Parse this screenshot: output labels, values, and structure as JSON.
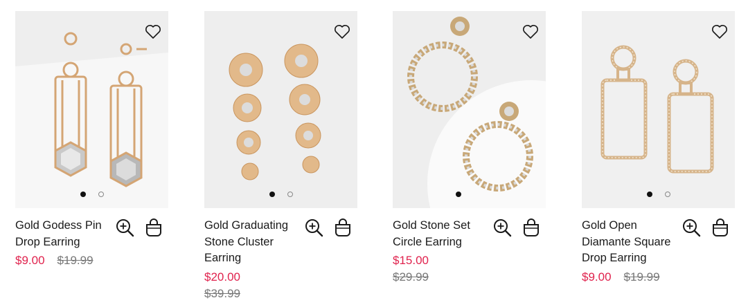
{
  "products": [
    {
      "name": "Gold Godess Pin Drop Earring",
      "price": "$9.00",
      "was_price": "$19.99",
      "image_dots": 2,
      "active_dot": 1,
      "icons": {
        "wishlist": "heart-outline-icon",
        "zoom": "zoom-in-icon",
        "bag": "shopping-bag-icon"
      }
    },
    {
      "name": "Gold Graduating Stone Cluster Earring",
      "price": "$20.00",
      "was_price": "$39.99",
      "image_dots": 2,
      "active_dot": 1,
      "icons": {
        "wishlist": "heart-outline-icon",
        "zoom": "zoom-in-icon",
        "bag": "shopping-bag-icon"
      }
    },
    {
      "name": "Gold Stone Set Circle Earring",
      "price": "$15.00",
      "was_price": "$29.99",
      "image_dots": 1,
      "active_dot": 1,
      "icons": {
        "wishlist": "heart-outline-icon",
        "zoom": "zoom-in-icon",
        "bag": "shopping-bag-icon"
      }
    },
    {
      "name": "Gold Open Diamante Square Drop Earring",
      "price": "$9.00",
      "was_price": "$19.99",
      "image_dots": 2,
      "active_dot": 1,
      "icons": {
        "wishlist": "heart-outline-icon",
        "zoom": "zoom-in-icon",
        "bag": "shopping-bag-icon"
      }
    }
  ],
  "colors": {
    "sale_price": "#e0224d",
    "was_price": "#777777",
    "text": "#1a1a1a",
    "image_bg": "#f1f1f1"
  }
}
